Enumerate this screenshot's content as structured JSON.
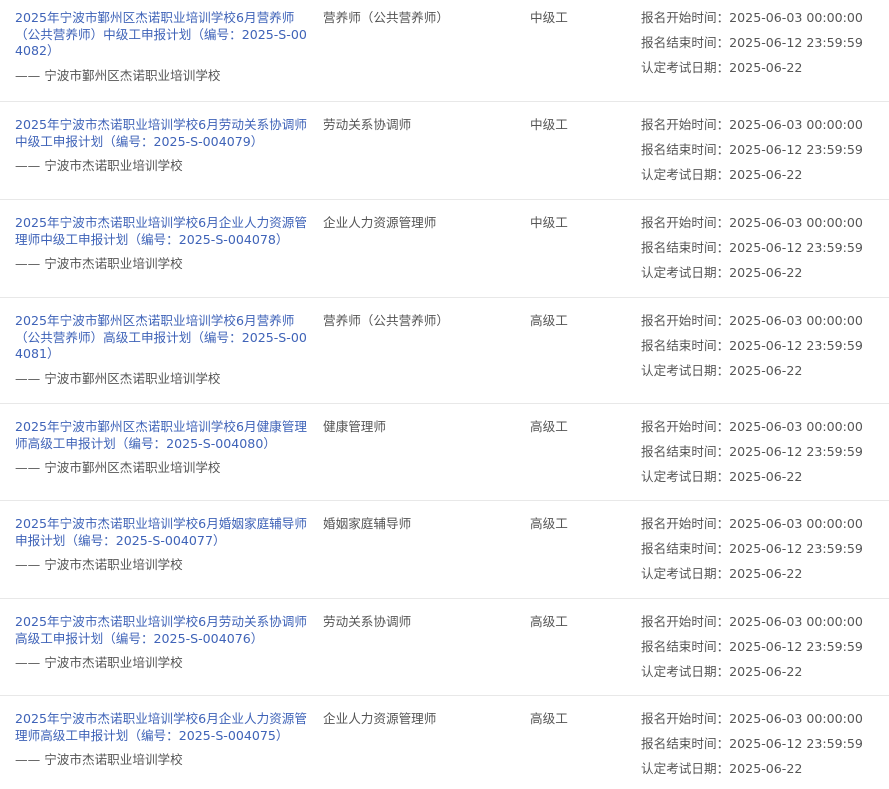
{
  "labels": {
    "reg_start": "报名开始时间：",
    "reg_end": "报名结束时间：",
    "exam_date": "认定考试日期："
  },
  "plans": [
    {
      "title": "2025年宁波市鄞州区杰诺职业培训学校6月营养师（公共营养师）中级工申报计划（编号：2025-S-004082）",
      "org": "—— 宁波市鄞州区杰诺职业培训学校",
      "occupation": "营养师（公共营养师）",
      "level": "中级工",
      "reg_start": "2025-06-03 00:00:00",
      "reg_end": "2025-06-12 23:59:59",
      "exam_date": "2025-06-22"
    },
    {
      "title": "2025年宁波市杰诺职业培训学校6月劳动关系协调师中级工申报计划（编号：2025-S-004079）",
      "org": "—— 宁波市杰诺职业培训学校",
      "occupation": "劳动关系协调师",
      "level": "中级工",
      "reg_start": "2025-06-03 00:00:00",
      "reg_end": "2025-06-12 23:59:59",
      "exam_date": "2025-06-22"
    },
    {
      "title": "2025年宁波市杰诺职业培训学校6月企业人力资源管理师中级工申报计划（编号：2025-S-004078）",
      "org": "—— 宁波市杰诺职业培训学校",
      "occupation": "企业人力资源管理师",
      "level": "中级工",
      "reg_start": "2025-06-03 00:00:00",
      "reg_end": "2025-06-12 23:59:59",
      "exam_date": "2025-06-22"
    },
    {
      "title": "2025年宁波市鄞州区杰诺职业培训学校6月营养师（公共营养师）高级工申报计划（编号：2025-S-004081）",
      "org": "—— 宁波市鄞州区杰诺职业培训学校",
      "occupation": "营养师（公共营养师）",
      "level": "高级工",
      "reg_start": "2025-06-03 00:00:00",
      "reg_end": "2025-06-12 23:59:59",
      "exam_date": "2025-06-22"
    },
    {
      "title": "2025年宁波市鄞州区杰诺职业培训学校6月健康管理师高级工申报计划（编号：2025-S-004080）",
      "org": "—— 宁波市鄞州区杰诺职业培训学校",
      "occupation": "健康管理师",
      "level": "高级工",
      "reg_start": "2025-06-03 00:00:00",
      "reg_end": "2025-06-12 23:59:59",
      "exam_date": "2025-06-22"
    },
    {
      "title": "2025年宁波市杰诺职业培训学校6月婚姻家庭辅导师申报计划（编号：2025-S-004077）",
      "org": "—— 宁波市杰诺职业培训学校",
      "occupation": "婚姻家庭辅导师",
      "level": "高级工",
      "reg_start": "2025-06-03 00:00:00",
      "reg_end": "2025-06-12 23:59:59",
      "exam_date": "2025-06-22"
    },
    {
      "title": "2025年宁波市杰诺职业培训学校6月劳动关系协调师高级工申报计划（编号：2025-S-004076）",
      "org": "—— 宁波市杰诺职业培训学校",
      "occupation": "劳动关系协调师",
      "level": "高级工",
      "reg_start": "2025-06-03 00:00:00",
      "reg_end": "2025-06-12 23:59:59",
      "exam_date": "2025-06-22"
    },
    {
      "title": "2025年宁波市杰诺职业培训学校6月企业人力资源管理师高级工申报计划（编号：2025-S-004075）",
      "org": "—— 宁波市杰诺职业培训学校",
      "occupation": "企业人力资源管理师",
      "level": "高级工",
      "reg_start": "2025-06-03 00:00:00",
      "reg_end": "2025-06-12 23:59:59",
      "exam_date": "2025-06-22"
    }
  ]
}
